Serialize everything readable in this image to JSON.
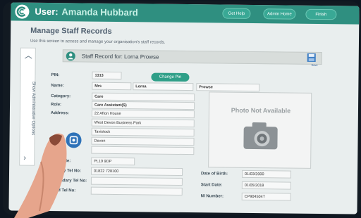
{
  "header": {
    "user_label": "User:",
    "user_name": "Amanda Hubbard",
    "buttons": [
      "Get Help",
      "Admin Home",
      "Finish"
    ]
  },
  "page": {
    "title": "Manage Staff Records",
    "description": "Use this screen to access and manage your organisation's staff records."
  },
  "side_panel": {
    "label": "Show Administrative Options"
  },
  "record": {
    "title": "Staff Record for:  Lorna Prowse",
    "save_label": "Save"
  },
  "form": {
    "pin_label": "PIN:",
    "pin_value": "1313",
    "change_pin": "Change Pin",
    "name_label": "Name:",
    "name_title": "Mrs",
    "name_first": "Lorna",
    "name_last": "Prowse",
    "category_label": "Category:",
    "category_value": "Care",
    "role_label": "Role:",
    "role_value": "Care Assistant(S)",
    "address_label": "Address:",
    "address_lines": [
      "22 Afton House",
      "West Devon Business Park",
      "Tavistock",
      "Devon",
      ""
    ],
    "postcode_label": "Postcode:",
    "postcode_value": "PL19 9DP",
    "primary_tel_label": "Primary Tel No:",
    "primary_tel_value": "01822 728100",
    "secondary_tel_label": "Secondary Tel No:",
    "third_tel_label": "Third Tel No:",
    "dob_label": "Date of Birth:",
    "dob_value": "01/03/2000",
    "start_label": "Start Date:",
    "start_value": "01/05/2018",
    "ni_label": "NI Number:",
    "ni_value": "CP904504T"
  },
  "photo": {
    "placeholder": "Photo Not Available"
  }
}
